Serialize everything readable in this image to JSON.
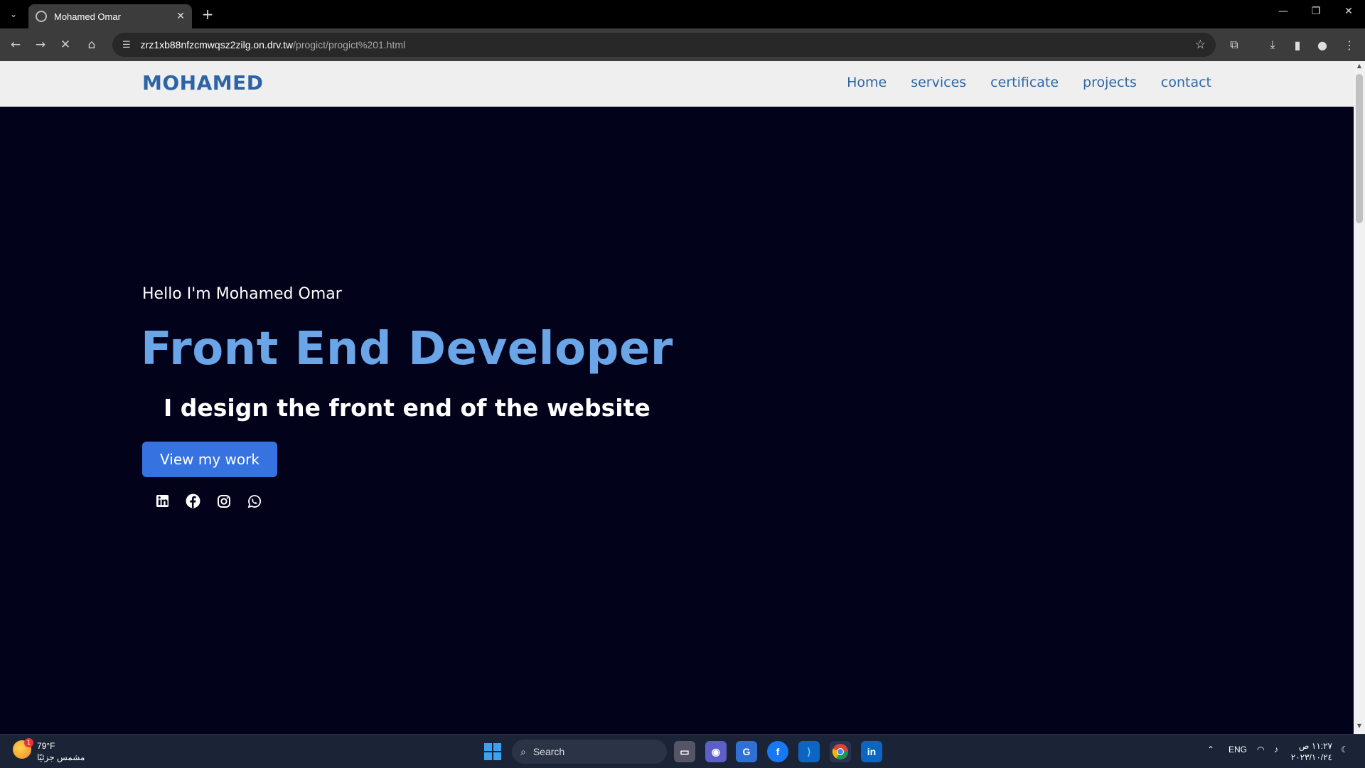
{
  "browser": {
    "tab_title": "Mohamed Omar",
    "url_host": "zrz1xb88nfzcmwqsz2zilg.on.drv.tw",
    "url_path": "/progict/progict%201.html"
  },
  "site": {
    "logo": "MOHAMED",
    "nav": [
      "Home",
      "services",
      "certificate",
      "projects",
      "contact"
    ],
    "hello": "Hello I'm Mohamed Omar",
    "role": "Front End Developer",
    "tagline": "I design the front end of the website",
    "cta": "View my work",
    "social": [
      "linkedin-icon",
      "facebook-icon",
      "instagram-icon",
      "whatsapp-icon"
    ],
    "colors": {
      "header_bg": "#efefef",
      "hero_bg": "#02021a",
      "accent": "#3673e0",
      "logo": "#2d64a6",
      "role": "#6aa5e8"
    }
  },
  "taskbar": {
    "weather_badge": "1",
    "temperature": "79°F",
    "weather_desc": "مشمس جزئيًا",
    "search_label": "Search",
    "lang": "ENG",
    "time": "١١:٢٧ ص",
    "date": "٢٠٢٣/١٠/٢٤"
  }
}
